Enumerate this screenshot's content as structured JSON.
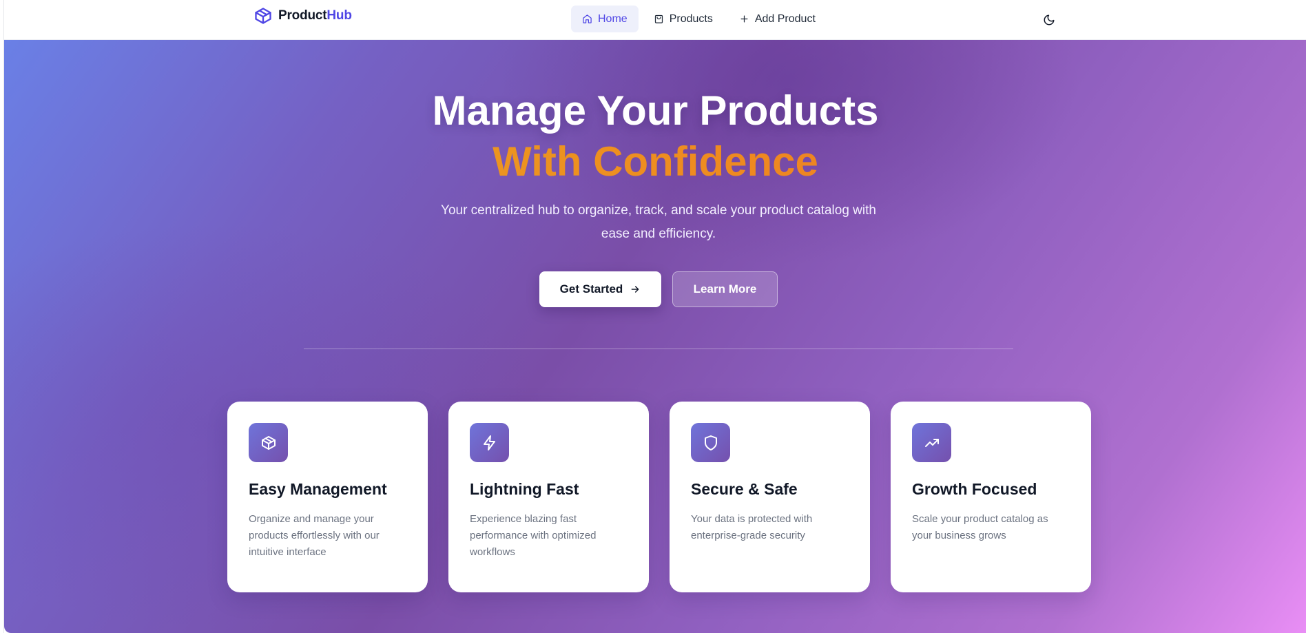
{
  "brand": {
    "name_part1": "Product",
    "name_part2": "Hub",
    "accent_color": "#4f46e5",
    "icon": "box-icon"
  },
  "nav": {
    "items": [
      {
        "label": "Home",
        "icon": "home-icon",
        "active": true
      },
      {
        "label": "Products",
        "icon": "shopping-bag-icon",
        "active": false
      },
      {
        "label": "Add Product",
        "icon": "plus-icon",
        "active": false
      }
    ],
    "theme_toggle_icon": "moon-icon"
  },
  "hero": {
    "title_line1": "Manage Your Products",
    "title_line2": "With Confidence",
    "subtitle": "Your centralized hub to organize, track, and scale your product catalog with ease and efficiency.",
    "primary_button": "Get Started",
    "secondary_button": "Learn More"
  },
  "features": [
    {
      "icon": "box-icon",
      "title": "Easy Management",
      "description": "Organize and manage your products effortlessly with our intuitive interface"
    },
    {
      "icon": "lightning-icon",
      "title": "Lightning Fast",
      "description": "Experience blazing fast performance with optimized workflows"
    },
    {
      "icon": "shield-icon",
      "title": "Secure & Safe",
      "description": "Your data is protected with enterprise-grade security"
    },
    {
      "icon": "trending-up-icon",
      "title": "Growth Focused",
      "description": "Scale your product catalog as your business grows"
    }
  ],
  "colors": {
    "title_gradient": [
      "#e8a922",
      "#f06a26"
    ],
    "hero_gradient": [
      "#6a80e6",
      "#7a4ea8",
      "#e98ef5"
    ],
    "card_icon_gradient": [
      "#6f74da",
      "#7550ad"
    ]
  }
}
